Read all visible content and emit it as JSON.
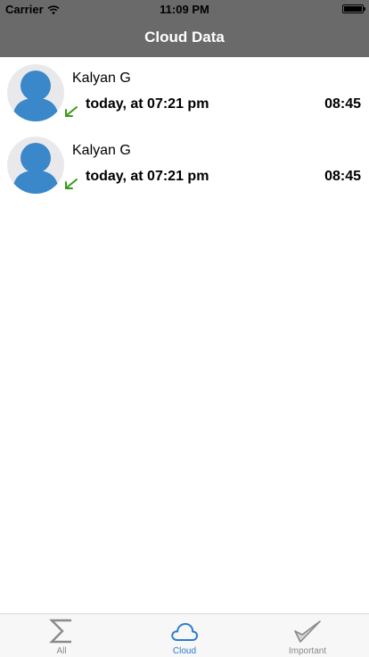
{
  "status_bar": {
    "carrier": "Carrier",
    "time": "11:09 PM"
  },
  "nav": {
    "title": "Cloud Data"
  },
  "calls": [
    {
      "name": "Kalyan G",
      "time": "today, at 07:21 pm",
      "duration": "08:45",
      "direction": "incoming"
    },
    {
      "name": "Kalyan G",
      "time": "today, at 07:21 pm",
      "duration": "08:45",
      "direction": "incoming"
    }
  ],
  "tabs": [
    {
      "label": "All",
      "icon": "sigma-icon",
      "active": false
    },
    {
      "label": "Cloud",
      "icon": "cloud-icon",
      "active": true
    },
    {
      "label": "Important",
      "icon": "check-icon",
      "active": false
    }
  ],
  "colors": {
    "bar": "#6a6a6a",
    "avatar": "#3a87c9",
    "arrow": "#3a9a1a",
    "accent": "#2d7ccf"
  }
}
